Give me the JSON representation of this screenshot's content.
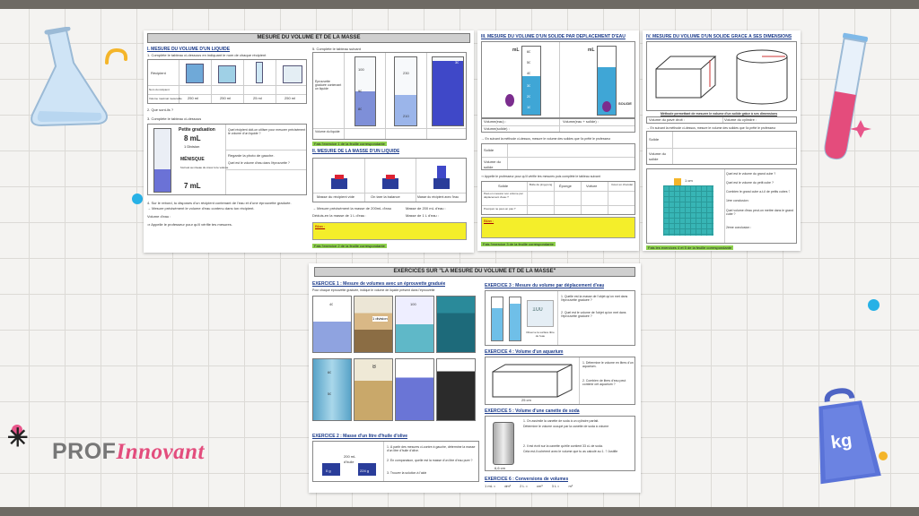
{
  "sheet1": {
    "title": "MESURE DU VOLUME ET DE LA MASSE",
    "s1": "I. MESURE DU VOLUME D'UN LIQUIDE",
    "q1": "1. Complète le tableau ci-dessous en indiquant le nom de chaque récipient",
    "recipient_label": "Récipient",
    "nom_label": "Nom du récipient",
    "vol_label": "Volume maximal mesurable",
    "vols": [
      "250 ml",
      "250 ml",
      "25 ml",
      "250 ml"
    ],
    "q2": "2. Que sont-ils ?",
    "q3": "3. Complète le tableau ci-dessous",
    "grad_petite": "Petite graduation",
    "grad_8": "8 mL",
    "grad_div": "1 Division",
    "menisque": "MÉNISQUE",
    "menisque_note": "l'œil est au niveau du creux lu le volume",
    "grad_7": "7 mL",
    "q_a": "Quel récipient doit-on utiliser pour mesurer précisément le volume d'un liquide ?",
    "q_b": "Regarde la photo de gauche.",
    "q_c": "Quel est le volume d'eau dans l'éprouvette ?",
    "q4": "4. Sur le rebord, tu disposes d'un récipient contenant de l'eau et d'une éprouvette graduée.",
    "q4b": "→ Mesure précisément le volume d'eau contenu dans ton récipient.",
    "q4c": "Volume d'eau :",
    "q4d": "⇒ Appelle le professeur pour qu'il vérifie tes mesures.",
    "q5": "5. Complète le tableau suivant",
    "tube_labels": [
      "100",
      "90",
      "80",
      "230",
      "210",
      "30"
    ],
    "eprouvette_label": "Éprouvette graduée contenant un liquide",
    "vol_liquide": "Volume du liquide",
    "green1": "Fais l'exercice 1 de la feuille correspondante",
    "s2": "II. MESURE DE LA MASSE D'UN LIQUIDE",
    "bal_labels": [
      "Masse du récipient vide",
      "On tare la balance",
      "Masse du récipient avec l'eau"
    ],
    "mass_lines": [
      "→ Mesure précisément la masse de 200mL d'eau",
      "Déduis-en la masse de 1 L d'eau :"
    ],
    "mass_right": [
      "Masse de 200 mL d'eau :",
      "Masse de 1 L d'eau :"
    ],
    "bilan": "Bilan :",
    "green2": "Fais l'exercice 2 de la feuille correspondante"
  },
  "sheet2": {
    "s3": "III. MESURE DU VOLUME D'UN SOLIDE PAR DÉPLACEMENT D'EAU",
    "scale": [
      "60",
      "50",
      "40",
      "30",
      "20",
      "10"
    ],
    "ml": "mL",
    "solide": "SOLIDE",
    "v1": "Volume(eau) :",
    "v2": "Volume(eau + solide) :",
    "v3": "Volume(solide) :",
    "q_method": "→ En suivant la méthode ci-dessus, mesure le volume des solides que t'a prêté le professeur",
    "solide_label": "Solide",
    "volume_solide": "Volume du solide",
    "q_table": "⇒ Appelle le professeur pour qu'il vérifie tes mesures puis complète le tableau suivant",
    "t_headers": [
      "Solide",
      "Boîte de ping-pong",
      "Éponge",
      "Voiture",
      "Cœur en chocolat"
    ],
    "t_rows": [
      "Peut-on mesurer son volume par déplacement d'eau ?",
      "Pourquoi ne peut-on pas ?"
    ],
    "bilan": "Bilan :",
    "green": "Fais l'exercice 3 de la feuille correspondante"
  },
  "sheet3": {
    "s4": "IV. MESURE DU VOLUME D'UN SOLIDE GRÂCE À SES DIMENSIONS",
    "methode": "Méthode permettant de mesurer le volume d'un solide grâce à ses dimensions",
    "pave": "Volume du pavé droit :",
    "cyl": "Volume du cylindre :",
    "q": "→ En suivant la méthode ci-dessus, mesure le volume des solides que t'a prêté le professeur",
    "solide_label": "Solide",
    "volume_solide": "Volume du solide",
    "cube_dim": "1 cm",
    "cube_q": [
      "Quel est le volume du grand cube ?",
      "Quel est le volume du petit cube ?",
      "Combien le grand cube a-t-il de petits cubes ?",
      "1ère conclusion :",
      "Quel volume d'eau peut-on mettre dans le grand cube ?",
      "2ème conclusion :"
    ],
    "green": "Fais les exercices 4 et 5 de la feuille correspondante"
  },
  "sheet4": {
    "title": "EXERCICES SUR \"LA MESURE DU VOLUME ET DE LA MASSE\"",
    "ex1": "EXERCICE 1 : Mesure de volumes avec un éprouvette graduée",
    "ex1_sub": "Pour chaque éprouvette graduée, indique le volume de liquide présent dans l'éprouvette",
    "photo_labels": [
      "40",
      "1 division",
      "100",
      "60",
      "8",
      "50"
    ],
    "ex2": "EXERCICE 2 : Masse d'un litre d'huile d'olive",
    "ex2_vals": [
      "0 g",
      "200 mL d'huile",
      "224 g"
    ],
    "ex2_q": [
      "1. À partir des mesures ci-contre à gauche, détermine la masse d'un litre d'huile d'olive.",
      "2. En comparaison, quelle est la masse d'un litre d'eau pure ?",
      "3. Trouver la solution à l'aide"
    ],
    "ex3": "EXERCICE 3 : Mesure du volume par déplacement d'eau",
    "ex3_q": [
      "1. Quelle est la masse de l'objet qu'on met dans l'éprouvette graduée ?",
      "2. Quel est le volume de l'objet qu'on met dans l'éprouvette graduée ?"
    ],
    "ex3_num": "100",
    "ex3_caption": "Observe la surface libre de l'eau",
    "ex4": "EXERCICE 4 : Volume d'un aquarium",
    "ex4_q": [
      "1. Détermine le volume en litres d'un aquarium.",
      "2. Combien de litres d'eau peut contenir cet aquarium ?"
    ],
    "ex4_dim": "25 cm",
    "ex5": "EXERCICE 5 : Volume d'une canette de soda",
    "ex5_q": [
      "1. On assimile la canette de soda à un cylindre parfait.",
      "Détermine le volume occupé par la canette de soda à volume",
      "2. Il est écrit sur la canette qu'elle contient 33 cL de soda.",
      "Cela est-il cohérent avec le volume que tu as calculé au 1. ? Justifie"
    ],
    "ex5_dim": "6,6 cm",
    "ex6": "EXERCICE 6 : Conversions de volumes",
    "ex6_items": [
      "1 mL =",
      "dm³",
      "2 L =",
      "cm³",
      "3 L =",
      "m³"
    ]
  },
  "brand": {
    "part1": "PROF",
    "part2": "Innovant"
  },
  "weight_label": "kg",
  "colors": {
    "pink": "#e34d7d",
    "blue": "#5a73d8",
    "cyan": "#27b1e6",
    "yellow": "#f4b52a",
    "green": "#8fd14f"
  }
}
